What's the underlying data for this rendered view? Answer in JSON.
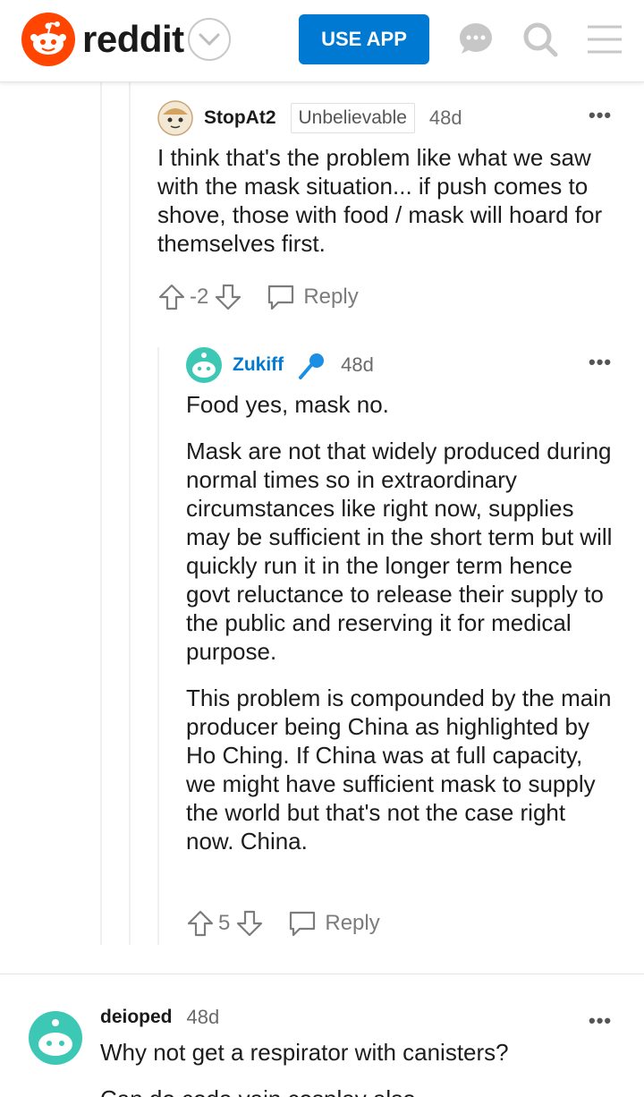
{
  "header": {
    "brand": "reddit",
    "use_app_label": "USE APP",
    "icons": [
      "reddit-logo-icon",
      "chevron-down-icon",
      "chat-icon",
      "search-icon",
      "menu-icon"
    ]
  },
  "comments": [
    {
      "username": "StopAt2",
      "flair": "Unbelievable",
      "age": "48d",
      "paragraphs": [
        "I think that's the problem like what we saw with the mask situation... if push comes to shove, those with food / mask will hoard for themselves first."
      ],
      "score": "-2",
      "reply_label": "Reply"
    },
    {
      "username": "Zukiff",
      "age": "48d",
      "paragraphs": [
        "Food yes, mask no.",
        "Mask are not that widely produced during normal times so in extraordinary circumstances like right now, supplies may be sufficient in the short term but will quickly run it in the longer term hence govt reluctance to release their supply to the public and reserving it for medical purpose.",
        "This problem is compounded by the main producer being China as highlighted by Ho Ching. If China was at full capacity, we might have sufficient mask to supply the world but that's not the case right now. China."
      ],
      "score": "5",
      "reply_label": "Reply"
    },
    {
      "username": "deioped",
      "age": "48d",
      "paragraphs": [
        "Why not get a respirator with canisters?",
        "Can do coda vain cosplay also"
      ]
    }
  ],
  "colors": {
    "brand_orange": "#ff4500",
    "use_app_blue": "#0079d3",
    "op_username_blue": "#0079d3",
    "mic_icon_blue": "#1a8fe3",
    "meta_gray": "#7c7c7c"
  }
}
